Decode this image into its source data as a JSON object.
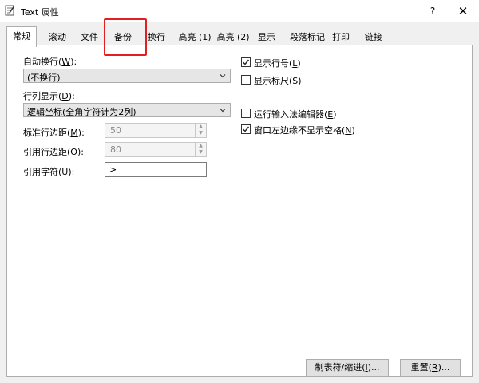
{
  "window": {
    "title": "Text 属性",
    "help_label": "?",
    "close_label": "✕"
  },
  "tabs": [
    {
      "label": "常规",
      "active": true
    },
    {
      "label": "滚动"
    },
    {
      "label": "文件"
    },
    {
      "label": "备份",
      "highlighted": true
    },
    {
      "label": "换行"
    },
    {
      "label": "高亮 (1)"
    },
    {
      "label": "高亮 (2)"
    },
    {
      "label": "显示"
    },
    {
      "label": "段落标记"
    },
    {
      "label": "打印"
    },
    {
      "label": "链接"
    }
  ],
  "general": {
    "wrap_label": {
      "pre": "自动换行(",
      "key": "W",
      "post": "):"
    },
    "wrap_value": "(不换行)",
    "rowcol_label": {
      "pre": "行列显示(",
      "key": "D",
      "post": "):"
    },
    "rowcol_value": "逻辑坐标(全角字符计为2列)",
    "std_margin_label": {
      "pre": "标准行边距(",
      "key": "M",
      "post": "):"
    },
    "std_margin_value": "50",
    "quote_margin_label": {
      "pre": "引用行边距(",
      "key": "O",
      "post": "):"
    },
    "quote_margin_value": "80",
    "quote_char_label": {
      "pre": "引用字符(",
      "key": "U",
      "post": "):"
    },
    "quote_char_value": ">"
  },
  "checkboxes": [
    {
      "pre": "显示行号(",
      "key": "L",
      "post": ")",
      "checked": true
    },
    {
      "pre": "显示标尺(",
      "key": "S",
      "post": ")",
      "checked": false
    },
    {
      "pre": "运行输入法编辑器(",
      "key": "E",
      "post": ")",
      "checked": false
    },
    {
      "pre": "窗口左边缘不显示空格(",
      "key": "N",
      "post": ")",
      "checked": true
    }
  ],
  "buttons": {
    "tabs_indent": {
      "pre": "制表符/缩进(",
      "key": "I",
      "post": ")..."
    },
    "reset": {
      "pre": "重置(",
      "key": "R",
      "post": ")..."
    }
  },
  "icons": {
    "app": "notepad-icon",
    "dropdown": "chevron-down-icon",
    "check": "checkmark-icon"
  }
}
